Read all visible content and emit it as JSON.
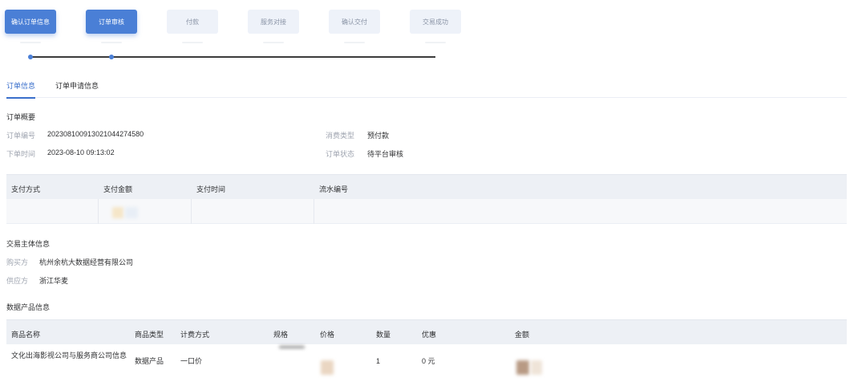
{
  "steps": [
    {
      "label": "确认订单信息",
      "active": true
    },
    {
      "label": "订单审核",
      "active": true
    },
    {
      "label": "付款",
      "active": false
    },
    {
      "label": "服务对接",
      "active": false
    },
    {
      "label": "确认交付",
      "active": false
    },
    {
      "label": "交易成功",
      "active": false
    }
  ],
  "tabs": {
    "order_info": "订单信息",
    "order_apply_info": "订单申请信息"
  },
  "summary": {
    "title": "订单概要",
    "order_no_label": "订单编号",
    "order_no": "20230810091302104427458​0",
    "order_time_label": "下单时间",
    "order_time": "2023-08-10 09:13:02",
    "consume_type_label": "消费类型",
    "consume_type": "预付款",
    "order_status_label": "订单状态",
    "order_status": "待平台审核"
  },
  "payment": {
    "headers": [
      "支付方式",
      "支付金额",
      "支付时间",
      "流水编号"
    ]
  },
  "parties": {
    "title": "交易主体信息",
    "buyer_label": "购买方",
    "buyer": "杭州余杭大数据经营有限公司",
    "supplier_label": "供应方",
    "supplier": "浙江华麦"
  },
  "products": {
    "title": "数据产品信息",
    "headers": [
      "商品名称",
      "商品类型",
      "计费方式",
      "规格",
      "价格",
      "数量",
      "优惠",
      "金额"
    ],
    "rows": [
      {
        "name": "文化出海影视公司与服务商公司信息",
        "type": "数据产品",
        "billing": "一口价",
        "spec": "",
        "price": "",
        "quantity": "1",
        "discount": "0 元",
        "amount": ""
      }
    ]
  }
}
